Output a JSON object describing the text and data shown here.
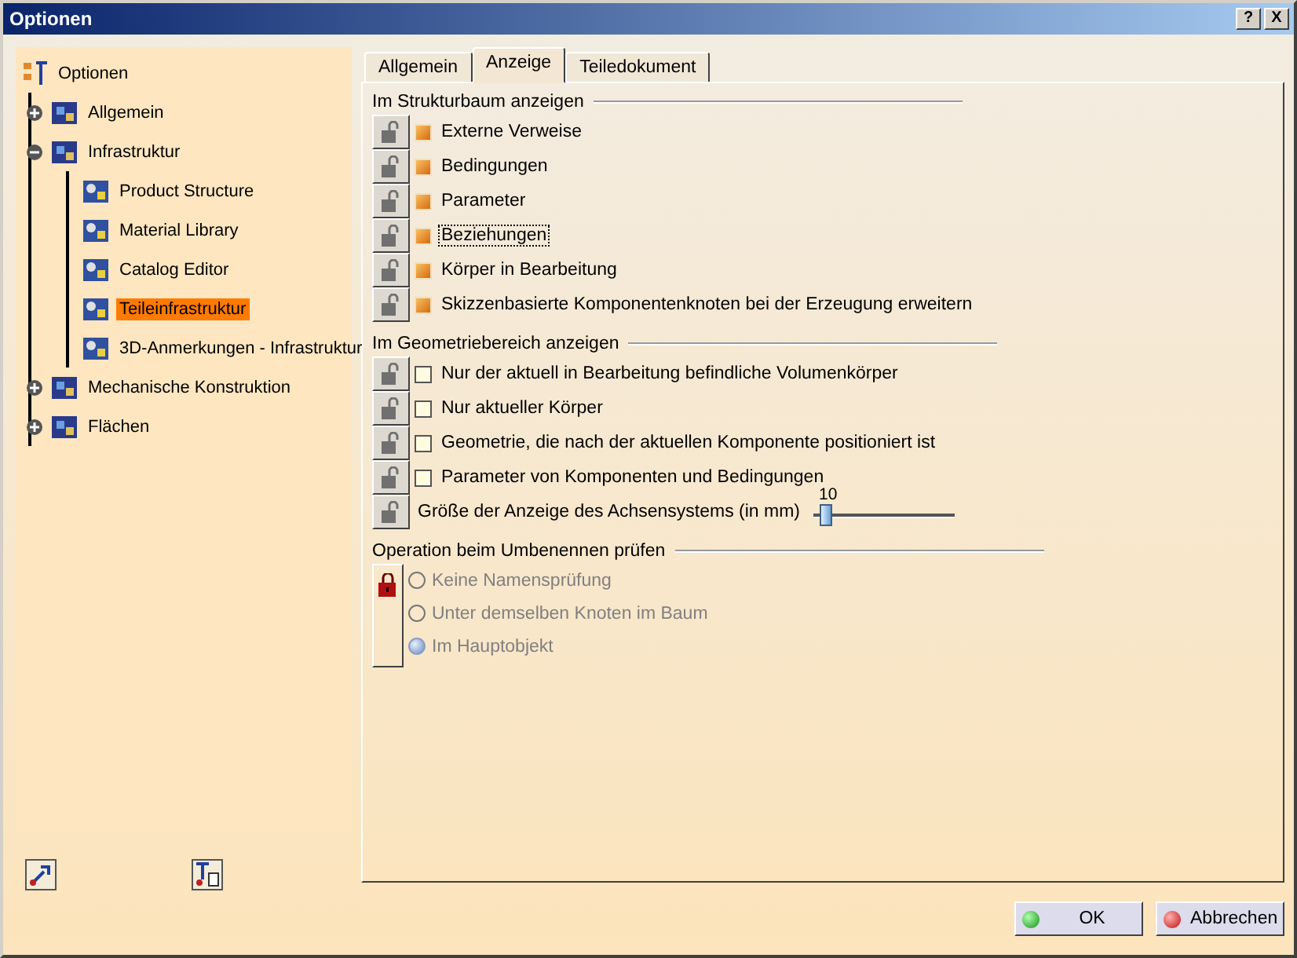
{
  "window": {
    "title": "Optionen",
    "help_button": "?",
    "close_button": "X"
  },
  "tree": {
    "label": "Optionen",
    "children": [
      {
        "label": "Allgemein",
        "expanded": false,
        "selected": false
      },
      {
        "label": "Infrastruktur",
        "expanded": true,
        "selected": false,
        "children": [
          {
            "label": "Product Structure",
            "selected": false
          },
          {
            "label": "Material Library",
            "selected": false
          },
          {
            "label": "Catalog Editor",
            "selected": false
          },
          {
            "label": "Teileinfrastruktur",
            "selected": true
          },
          {
            "label": "3D-Anmerkungen - Infrastruktur",
            "selected": false
          }
        ]
      },
      {
        "label": "Mechanische Konstruktion",
        "expanded": false,
        "selected": false
      },
      {
        "label": "Flächen",
        "expanded": false,
        "selected": false
      }
    ]
  },
  "tabs": [
    {
      "label": "Allgemein",
      "selected": false
    },
    {
      "label": "Anzeige",
      "selected": true
    },
    {
      "label": "Teiledokument",
      "selected": false
    }
  ],
  "groups": [
    {
      "title": "Im Strukturbaum anzeigen",
      "items": [
        {
          "kind": "checkbox",
          "label": "Externe Verweise",
          "checked": true,
          "focused": false
        },
        {
          "kind": "checkbox",
          "label": "Bedingungen",
          "checked": true,
          "focused": false
        },
        {
          "kind": "checkbox",
          "label": "Parameter",
          "checked": true,
          "focused": false
        },
        {
          "kind": "checkbox",
          "label": "Beziehungen",
          "checked": true,
          "focused": true
        },
        {
          "kind": "checkbox",
          "label": "Körper in Bearbeitung",
          "checked": true,
          "focused": false
        },
        {
          "kind": "checkbox",
          "label": "Skizzenbasierte Komponentenknoten bei der Erzeugung erweitern",
          "checked": true,
          "focused": false
        }
      ]
    },
    {
      "title": "Im Geometriebereich anzeigen",
      "items": [
        {
          "kind": "checkbox",
          "label": "Nur der aktuell in Bearbeitung befindliche Volumenkörper",
          "checked": false,
          "focused": false
        },
        {
          "kind": "checkbox",
          "label": "Nur aktueller Körper",
          "checked": false,
          "focused": false
        },
        {
          "kind": "checkbox",
          "label": "Geometrie, die nach der aktuellen Komponente positioniert ist",
          "checked": false,
          "focused": false
        },
        {
          "kind": "checkbox",
          "label": "Parameter von Komponenten und Bedingungen",
          "checked": false,
          "focused": false
        },
        {
          "kind": "slider",
          "label": "Größe der Anzeige des Achsensystems (in mm)",
          "reading": "10",
          "level": 0.05
        }
      ]
    },
    {
      "title": "Operation beim Umbenennen prüfen",
      "locked": true,
      "items": [
        {
          "kind": "radio",
          "label": "Keine Namensprüfung",
          "selected": false,
          "disabled": true
        },
        {
          "kind": "radio",
          "label": "Unter demselben Knoten im Baum",
          "selected": false,
          "disabled": true
        },
        {
          "kind": "radio",
          "label": "Im Hauptobjekt",
          "selected": true,
          "disabled": true
        }
      ]
    }
  ],
  "buttons": [
    {
      "label": "OK",
      "kind": "ok"
    },
    {
      "label": "Abbrechen",
      "kind": "cancel"
    }
  ]
}
